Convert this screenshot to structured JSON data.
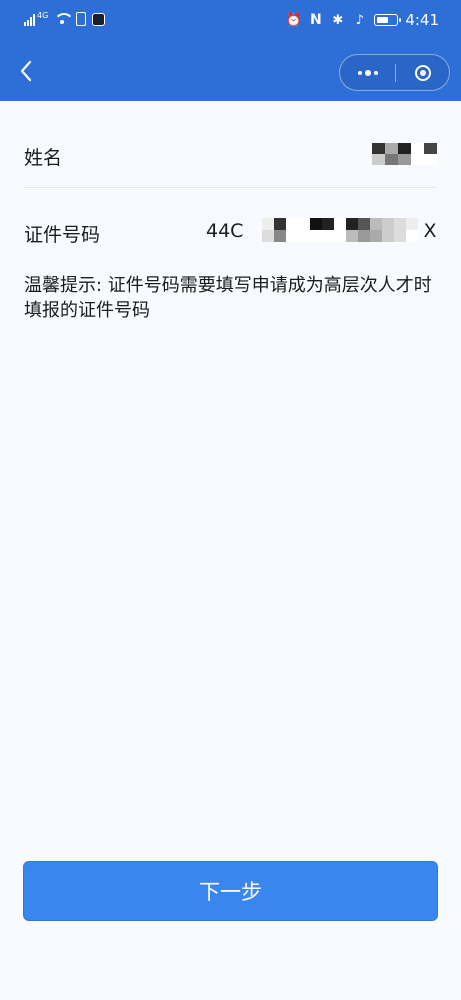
{
  "status_bar": {
    "network_label": "4G",
    "time": "4:41",
    "battery_level": 0.6,
    "icons": [
      "signal-icon",
      "wifi-icon",
      "sim-icon",
      "app-notification-icon",
      "alarm-icon",
      "nfc-icon",
      "bluetooth-icon",
      "vibrate-icon",
      "battery-icon"
    ]
  },
  "nav": {
    "back_icon": "chevron-left-icon",
    "more_icon": "more-dots-icon",
    "close_icon": "target-close-icon"
  },
  "form": {
    "name_label": "姓名",
    "id_label": "证件号码",
    "id_value_prefix": "44C",
    "id_value_suffix": "X"
  },
  "tip": "温馨提示: 证件号码需要填写申请成为高层次人才时填报的证件号码",
  "next_button": "下一步",
  "colors": {
    "header": "#2d6fd6",
    "button": "#3986ee",
    "background": "#f7fafe"
  }
}
